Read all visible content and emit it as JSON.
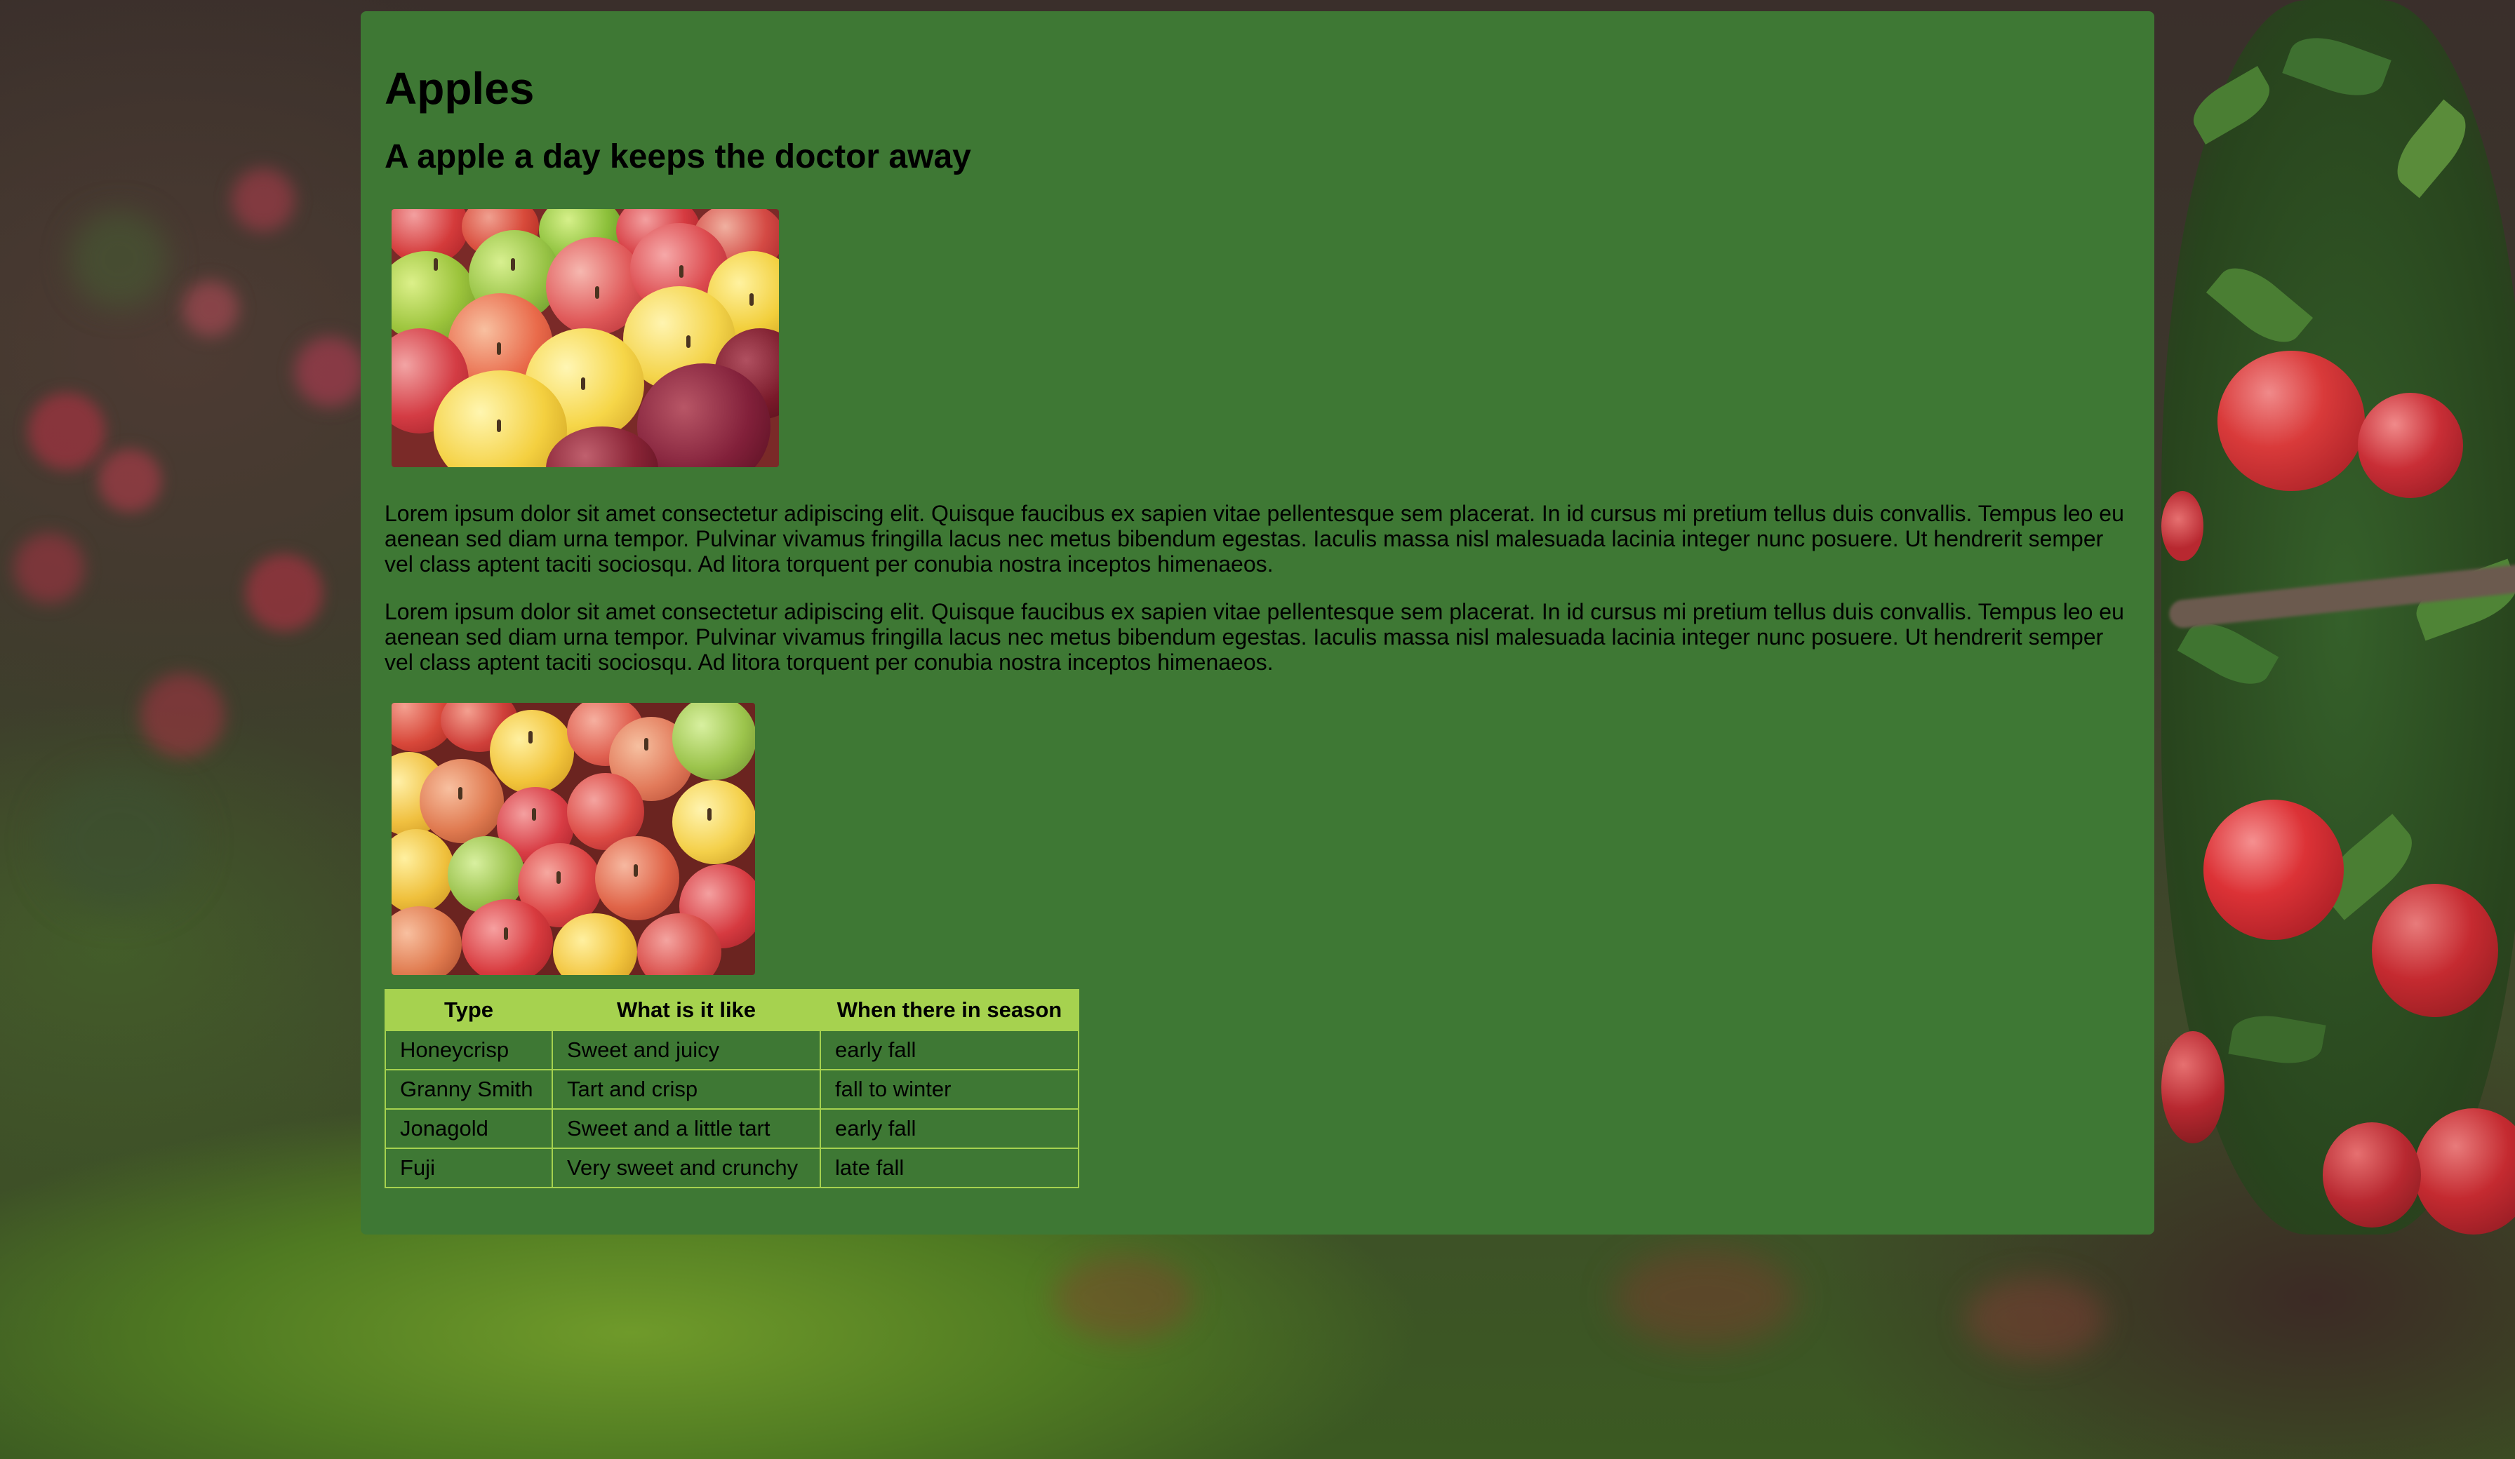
{
  "page": {
    "title": "Apples",
    "subtitle": "A apple a day keeps the doctor away"
  },
  "images": {
    "top": {
      "alt": "Assorted red, green and yellow apples"
    },
    "bottom": {
      "alt": "Pile of mixed apples"
    }
  },
  "paragraphs": [
    "Lorem ipsum dolor sit amet consectetur adipiscing elit. Quisque faucibus ex sapien vitae pellentesque sem placerat. In id cursus mi pretium tellus duis convallis. Tempus leo eu aenean sed diam urna tempor. Pulvinar vivamus fringilla lacus nec metus bibendum egestas. Iaculis massa nisl malesuada lacinia integer nunc posuere. Ut hendrerit semper vel class aptent taciti sociosqu. Ad litora torquent per conubia nostra inceptos himenaeos.",
    "Lorem ipsum dolor sit amet consectetur adipiscing elit. Quisque faucibus ex sapien vitae pellentesque sem placerat. In id cursus mi pretium tellus duis convallis. Tempus leo eu aenean sed diam urna tempor. Pulvinar vivamus fringilla lacus nec metus bibendum egestas. Iaculis massa nisl malesuada lacinia integer nunc posuere. Ut hendrerit semper vel class aptent taciti sociosqu. Ad litora torquent per conubia nostra inceptos himenaeos."
  ],
  "table": {
    "headers": [
      "Type",
      "What is it like",
      "When there in season"
    ],
    "rows": [
      [
        "Honeycrisp",
        "Sweet and juicy",
        "early fall"
      ],
      [
        "Granny Smith",
        "Tart and crisp",
        "fall to winter"
      ],
      [
        "Jonagold",
        "Sweet and a little tart",
        "early fall"
      ],
      [
        "Fuji",
        "Very sweet and crunchy",
        "late fall"
      ]
    ]
  },
  "colors": {
    "panel": "#3e7834",
    "table_header": "#a6d24f",
    "table_border": "#a6d24f"
  }
}
